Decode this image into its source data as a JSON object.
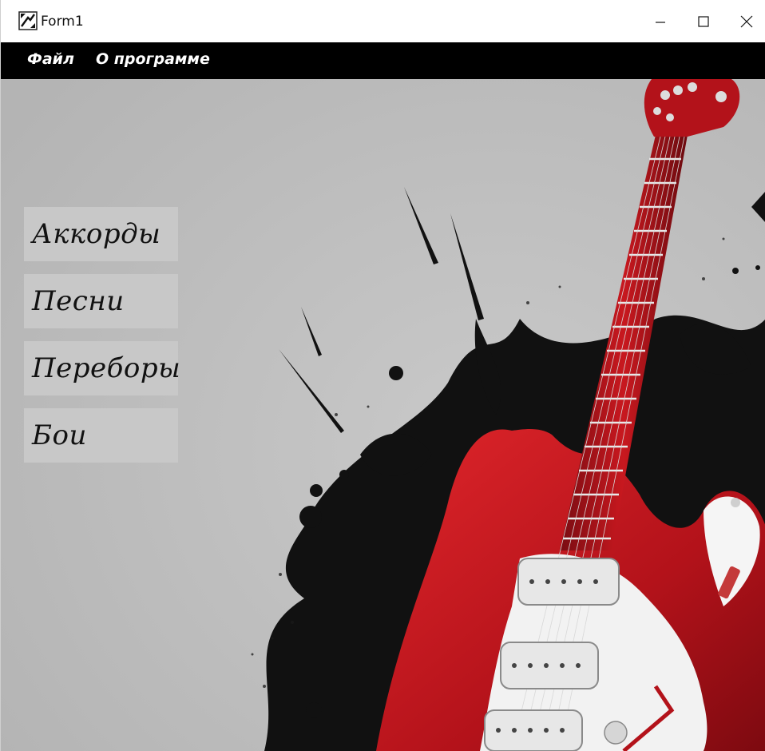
{
  "window": {
    "title": "Form1",
    "controls": {
      "minimize": "minimize",
      "maximize": "maximize",
      "close": "close"
    }
  },
  "menu": {
    "items": [
      {
        "label": "Файл"
      },
      {
        "label": "О программе"
      }
    ]
  },
  "main": {
    "buttons": [
      {
        "label": "Аккорды"
      },
      {
        "label": "Песни"
      },
      {
        "label": "Переборы"
      },
      {
        "label": "Бои"
      }
    ],
    "background": "guitar-splash-image"
  },
  "icons": {
    "app": "app-icon",
    "minimize": "minimize-icon",
    "maximize": "maximize-icon",
    "close": "close-icon"
  },
  "colors": {
    "menubar": "#000000",
    "content_bg": "#bfbfbf",
    "button_bg": "#c8c8c8",
    "guitar_red": "#c0161c"
  }
}
